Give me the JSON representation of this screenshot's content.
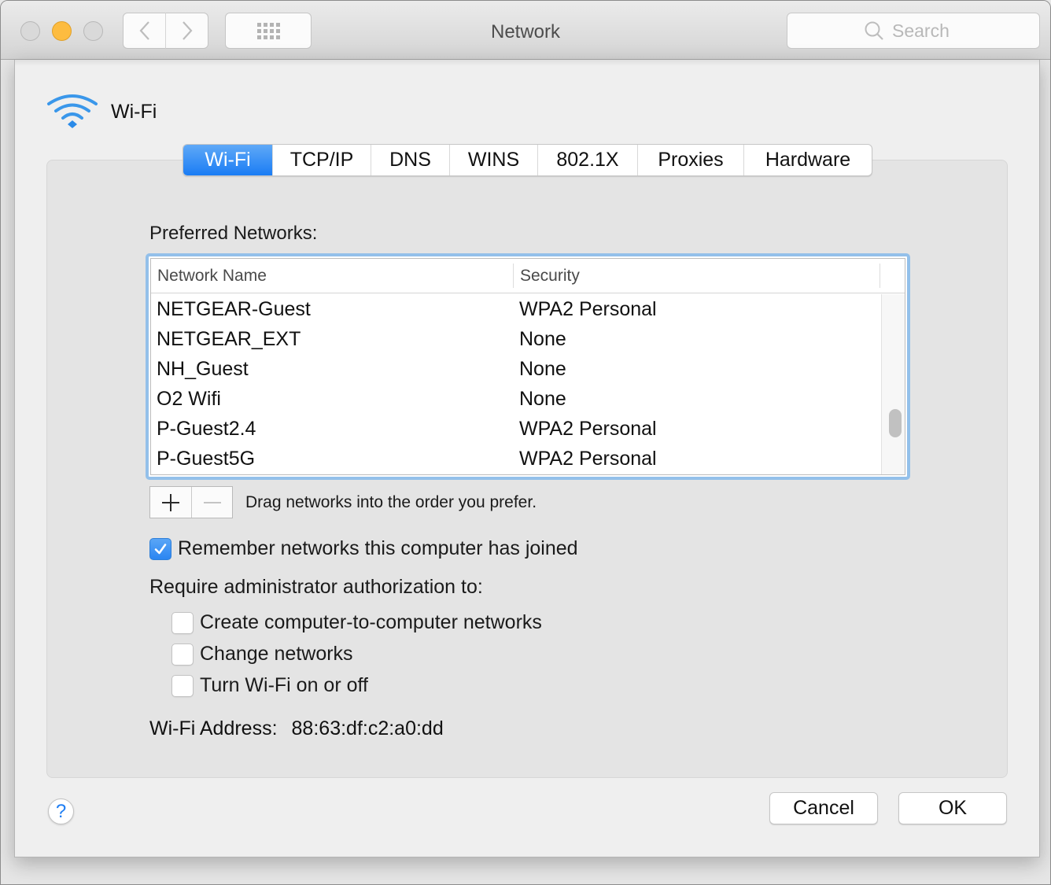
{
  "window": {
    "title": "Network",
    "search": {
      "placeholder": "Search",
      "value": ""
    },
    "colors": {
      "close": "#d9d9d9",
      "minimize": "#fdbc40",
      "zoom": "#d9d9d9"
    }
  },
  "sheet": {
    "header_title": "Wi-Fi",
    "tabs": [
      {
        "label": "Wi-Fi",
        "active": true
      },
      {
        "label": "TCP/IP",
        "active": false
      },
      {
        "label": "DNS",
        "active": false
      },
      {
        "label": "WINS",
        "active": false
      },
      {
        "label": "802.1X",
        "active": false
      },
      {
        "label": "Proxies",
        "active": false
      },
      {
        "label": "Hardware",
        "active": false
      }
    ],
    "preferred_networks_label": "Preferred Networks:",
    "table": {
      "columns": [
        "Network Name",
        "Security"
      ],
      "rows": [
        {
          "name": "NETGEAR-Guest",
          "security": "WPA2 Personal"
        },
        {
          "name": "NETGEAR_EXT",
          "security": "None"
        },
        {
          "name": "NH_Guest",
          "security": "None"
        },
        {
          "name": "O2 Wifi",
          "security": "None"
        },
        {
          "name": "P-Guest2.4",
          "security": "WPA2 Personal"
        },
        {
          "name": "P-Guest5G",
          "security": "WPA2 Personal"
        }
      ]
    },
    "drag_hint": "Drag networks into the order you prefer.",
    "remember_networks": {
      "label": "Remember networks this computer has joined",
      "checked": true
    },
    "require_admin_label": "Require administrator authorization to:",
    "admin_options": [
      {
        "label": "Create computer-to-computer networks",
        "checked": false
      },
      {
        "label": "Change networks",
        "checked": false
      },
      {
        "label": "Turn Wi-Fi on or off",
        "checked": false
      }
    ],
    "address_label": "Wi-Fi Address:",
    "address_value": "88:63:df:c2:a0:dd",
    "help_label": "?",
    "cancel_label": "Cancel",
    "ok_label": "OK",
    "accent_color": "#1a7cf4"
  }
}
